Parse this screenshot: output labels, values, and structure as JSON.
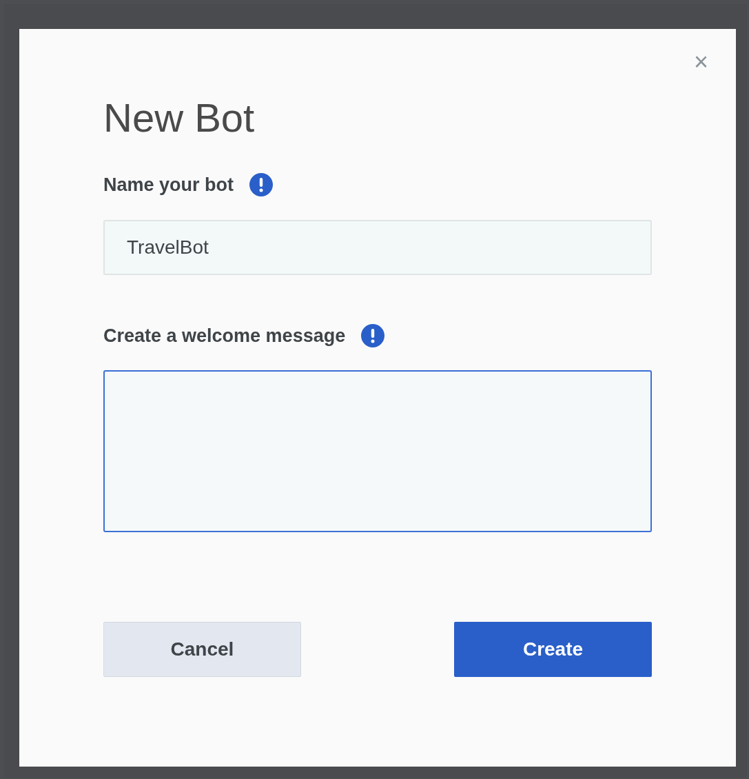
{
  "dialog": {
    "title": "New Bot",
    "close": "×"
  },
  "fields": [
    {
      "kind": "input",
      "label": "Name your bot",
      "value": "TravelBot",
      "focused": false
    },
    {
      "kind": "textarea",
      "label": "Create a welcome message",
      "focused": true
    }
  ],
  "buttons": [
    {
      "label": "Cancel",
      "primary": false
    },
    {
      "label": "Create",
      "primary": true
    }
  ]
}
